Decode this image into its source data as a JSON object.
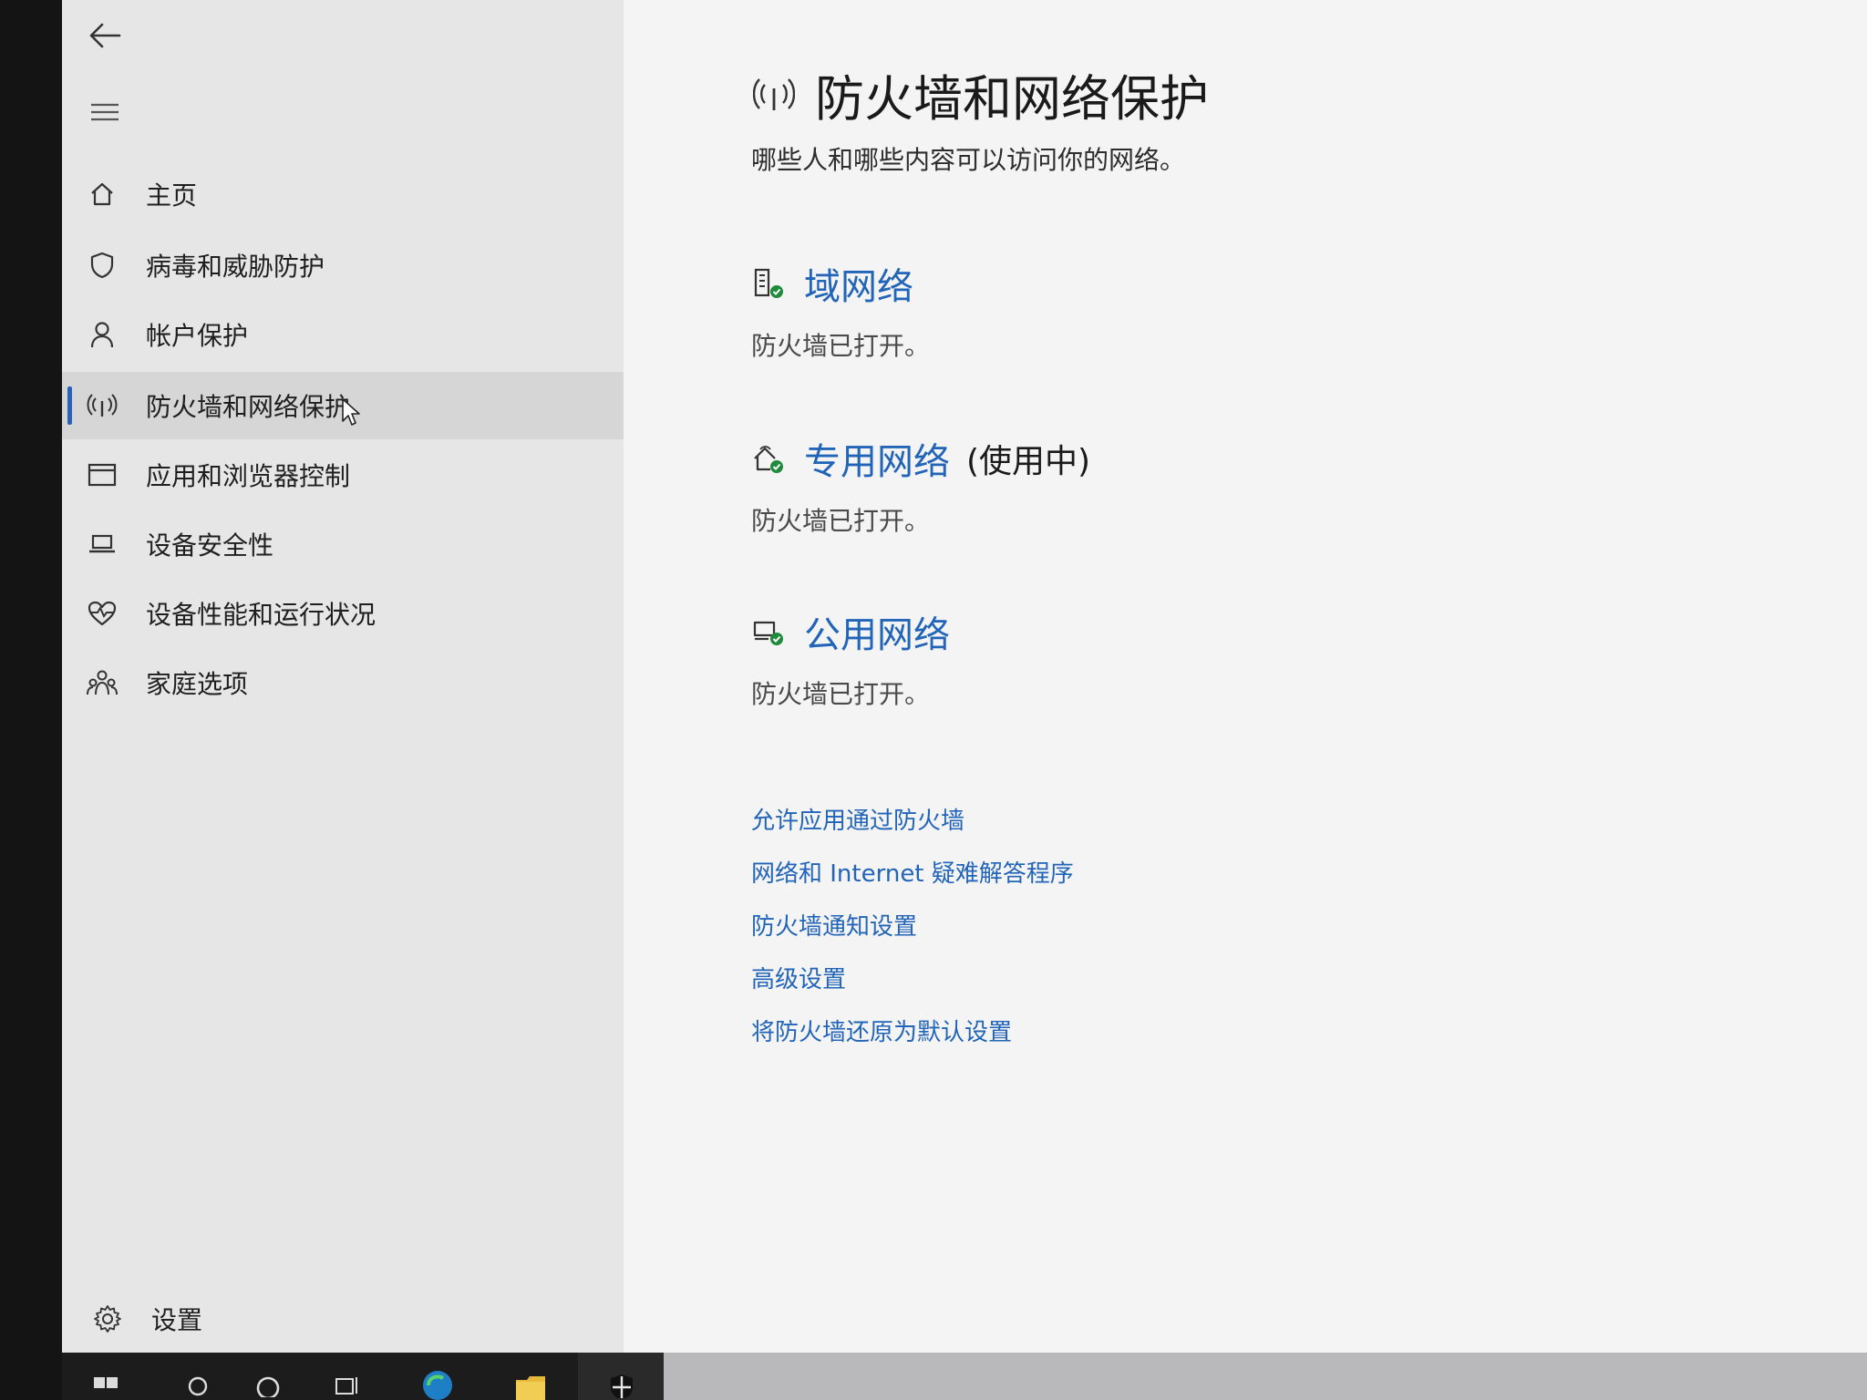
{
  "sidebar": {
    "items": [
      {
        "label": "主页",
        "icon": "home-icon"
      },
      {
        "label": "病毒和威胁防护",
        "icon": "shield-icon"
      },
      {
        "label": "帐户保护",
        "icon": "person-icon"
      },
      {
        "label": "防火墙和网络保护",
        "icon": "antenna-icon",
        "selected": true
      },
      {
        "label": "应用和浏览器控制",
        "icon": "app-window-icon"
      },
      {
        "label": "设备安全性",
        "icon": "laptop-icon"
      },
      {
        "label": "设备性能和运行状况",
        "icon": "heart-icon"
      },
      {
        "label": "家庭选项",
        "icon": "family-icon"
      }
    ],
    "settings_label": "设置"
  },
  "header": {
    "title": "防火墙和网络保护",
    "subtitle": "哪些人和哪些内容可以访问你的网络。"
  },
  "networks": [
    {
      "name": "域网络",
      "status": "防火墙已打开。",
      "active_label": ""
    },
    {
      "name": "专用网络",
      "status": "防火墙已打开。",
      "active_label": "(使用中)"
    },
    {
      "name": "公用网络",
      "status": "防火墙已打开。",
      "active_label": ""
    }
  ],
  "links": [
    "允许应用通过防火墙",
    "网络和 Internet 疑难解答程序",
    "防火墙通知设置",
    "高级设置",
    "将防火墙还原为默认设置"
  ],
  "colors": {
    "accent": "#2265b8",
    "sidebar_bg": "#e6e6e6",
    "main_bg": "#f4f4f4",
    "status_ok": "#1e8a3a"
  }
}
